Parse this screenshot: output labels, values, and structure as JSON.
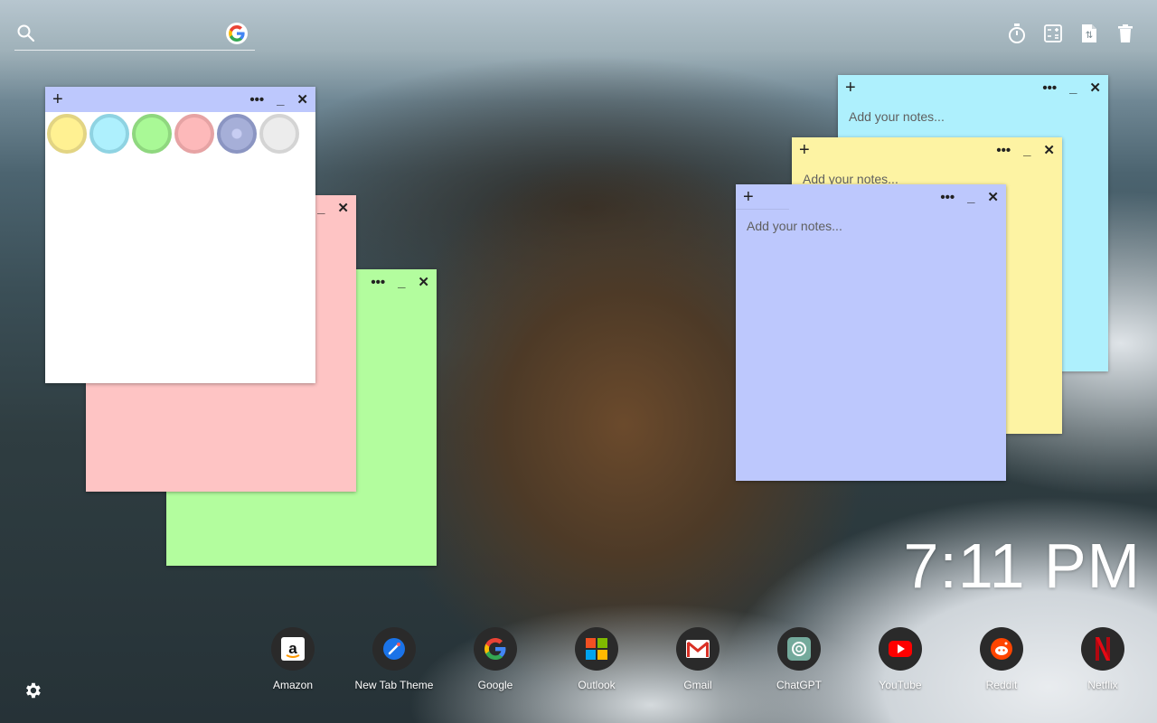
{
  "search": {
    "placeholder": "",
    "engine_icon": "google-icon"
  },
  "top_icons": [
    "timer-icon",
    "calculator-icon",
    "document-icon",
    "trash-icon"
  ],
  "notes": [
    {
      "id": "blue",
      "color": "#aef0fd",
      "placeholder": "Add your notes..."
    },
    {
      "id": "yellow",
      "color": "#fdf3a3",
      "placeholder": "Add your notes..."
    },
    {
      "id": "lavender",
      "color": "#bdc8fd",
      "placeholder": "Add your notes..."
    },
    {
      "id": "green",
      "color": "#b3fd9e",
      "placeholder": ""
    },
    {
      "id": "pink",
      "color": "#fec4c4",
      "placeholder": ""
    },
    {
      "id": "white",
      "color": "#ffffff",
      "placeholder": ""
    }
  ],
  "color_picker": {
    "swatches": [
      {
        "name": "yellow",
        "fill": "#fff192",
        "ring": "#e2d483"
      },
      {
        "name": "blue",
        "fill": "#aef0fd",
        "ring": "#8fd3e2"
      },
      {
        "name": "green",
        "fill": "#a9f996",
        "ring": "#8fd77f"
      },
      {
        "name": "pink",
        "fill": "#fdb9ba",
        "ring": "#e6a3a4"
      },
      {
        "name": "lavender",
        "fill": "#a6afd8",
        "ring": "#8b95c2",
        "selected": true
      },
      {
        "name": "white",
        "fill": "#ececec",
        "ring": "#d4d4d4"
      }
    ]
  },
  "clock": {
    "time": "7:11 PM"
  },
  "dock": [
    {
      "label": "Amazon",
      "icon": "amazon-icon"
    },
    {
      "label": "New Tab Theme",
      "icon": "new-tab-theme-icon"
    },
    {
      "label": "Google",
      "icon": "google-icon"
    },
    {
      "label": "Outlook",
      "icon": "outlook-icon"
    },
    {
      "label": "Gmail",
      "icon": "gmail-icon"
    },
    {
      "label": "ChatGPT",
      "icon": "chatgpt-icon"
    },
    {
      "label": "YouTube",
      "icon": "youtube-icon"
    },
    {
      "label": "Reddit",
      "icon": "reddit-icon"
    },
    {
      "label": "Netflix",
      "icon": "netflix-icon"
    }
  ],
  "note_controls": {
    "add": "+",
    "more": "•••",
    "minimize": "_",
    "close": "✕"
  }
}
